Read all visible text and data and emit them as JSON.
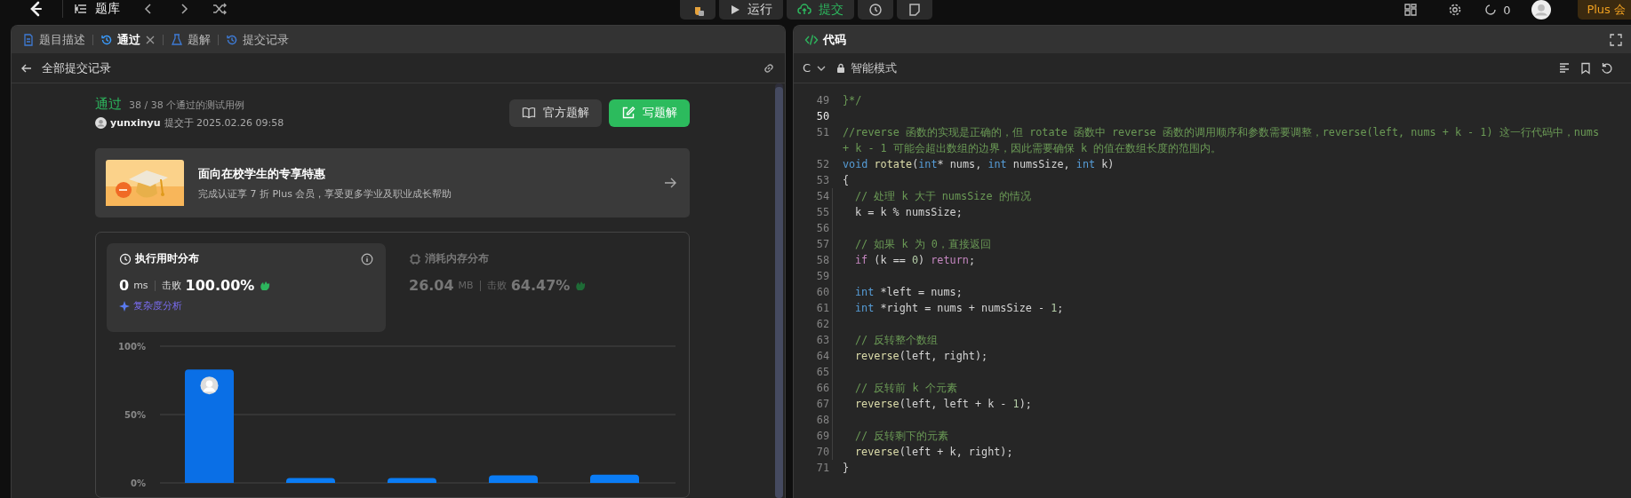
{
  "topbar": {
    "nav_label": "题库",
    "run_button": "运行",
    "submit_button": "提交",
    "streak": "0",
    "plus_label": "Plus 会"
  },
  "left_panel": {
    "tabs": [
      {
        "label": "题目描述",
        "selected": false,
        "closable": false
      },
      {
        "label": "通过",
        "selected": true,
        "closable": true
      },
      {
        "label": "题解",
        "selected": false,
        "closable": false
      },
      {
        "label": "提交记录",
        "selected": false,
        "closable": false
      }
    ],
    "back_label": "全部提交记录",
    "result": {
      "status": "通过",
      "passed": "38 / 38 个通过的测试用例",
      "user": "yunxinyu",
      "submitted": "提交于 2025.02.26 09:58"
    },
    "buttons": [
      {
        "label": "官方题解",
        "kind": "secondary"
      },
      {
        "label": "写题解",
        "kind": "primary"
      }
    ],
    "promo": {
      "title": "面向在校学生的专享特惠",
      "subtitle": "完成认证享 7 折 Plus 会员，享受更多学业及职业成长帮助"
    },
    "stats": [
      {
        "title": "执行用时分布",
        "selected": true,
        "value": "0",
        "unit": "ms",
        "beats_label": "击败",
        "beats": "100.00%",
        "link": "复杂度分析"
      },
      {
        "title": "消耗内存分布",
        "selected": false,
        "value": "26.04",
        "unit": "MB",
        "beats_label": "击败",
        "beats": "64.47%"
      }
    ],
    "chart_data": {
      "type": "bar",
      "values": [
        83,
        3.5,
        3.5,
        5.5,
        6
      ],
      "ylim": [
        0,
        100
      ],
      "yticks": [
        {
          "value": 0,
          "label": "0%"
        },
        {
          "value": 50,
          "label": "50%"
        },
        {
          "value": 100,
          "label": "100%"
        }
      ]
    },
    "chart_user_marker": true
  },
  "right_panel": {
    "title": "代码",
    "language": "C",
    "mode": "智能模式",
    "lines": [
      {
        "no": "49",
        "active": false,
        "indented": false,
        "tokens": [
          {
            "text": "}*/",
            "kind": "comment"
          }
        ]
      },
      {
        "no": "50",
        "active": true,
        "indented": false
      },
      {
        "no": "51",
        "active": false,
        "indented": false,
        "tokens": [
          {
            "text": "//reverse 函数的实现是正确的，但 rotate 函数中 reverse 函数的调用顺序和参数需要调整，reverse(left, nums + k - 1) 这一行代码中，nums + k - 1 可能会超出数组的边界，因此需要确保 k 的值在数组长度的范围内。",
            "kind": "comment"
          }
        ]
      },
      {
        "no": "52",
        "active": false,
        "indented": false,
        "tokens": [
          {
            "text": "void ",
            "kind": "keyword"
          },
          {
            "text": "rotate",
            "kind": "function"
          },
          {
            "text": "(",
            "kind": "plain"
          },
          {
            "text": "int",
            "kind": "keyword"
          },
          {
            "text": "* nums, ",
            "kind": "plain"
          },
          {
            "text": "int",
            "kind": "keyword"
          },
          {
            "text": " numsSize, ",
            "kind": "plain"
          },
          {
            "text": "int",
            "kind": "keyword"
          },
          {
            "text": " k)",
            "kind": "plain"
          }
        ]
      },
      {
        "no": "53",
        "active": false,
        "indented": false,
        "tokens": [
          {
            "text": "{",
            "kind": "plain"
          }
        ]
      },
      {
        "no": "54",
        "active": false,
        "indented": true,
        "tokens": [
          {
            "text": "// 处理 k 大于 numsSize 的情况",
            "kind": "comment"
          }
        ]
      },
      {
        "no": "55",
        "active": false,
        "indented": true,
        "tokens": [
          {
            "text": "k = k % numsSize;",
            "kind": "plain"
          }
        ]
      },
      {
        "no": "56",
        "active": false,
        "indented": true
      },
      {
        "no": "57",
        "active": false,
        "indented": true,
        "tokens": [
          {
            "text": "// 如果 k 为 0，直接返回",
            "kind": "comment"
          }
        ]
      },
      {
        "no": "58",
        "active": false,
        "indented": true,
        "tokens": [
          {
            "text": "if",
            "kind": "control"
          },
          {
            "text": " (k == ",
            "kind": "plain"
          },
          {
            "text": "0",
            "kind": "number"
          },
          {
            "text": ") ",
            "kind": "plain"
          },
          {
            "text": "return",
            "kind": "control"
          },
          {
            "text": ";",
            "kind": "plain"
          }
        ]
      },
      {
        "no": "59",
        "active": false,
        "indented": true
      },
      {
        "no": "60",
        "active": false,
        "indented": true,
        "tokens": [
          {
            "text": "int",
            "kind": "keyword"
          },
          {
            "text": " *left = nums;",
            "kind": "plain"
          }
        ]
      },
      {
        "no": "61",
        "active": false,
        "indented": true,
        "tokens": [
          {
            "text": "int",
            "kind": "keyword"
          },
          {
            "text": " *right = nums + numsSize - ",
            "kind": "plain"
          },
          {
            "text": "1",
            "kind": "number"
          },
          {
            "text": ";",
            "kind": "plain"
          }
        ]
      },
      {
        "no": "62",
        "active": false,
        "indented": true
      },
      {
        "no": "63",
        "active": false,
        "indented": true,
        "tokens": [
          {
            "text": "// 反转整个数组",
            "kind": "comment"
          }
        ]
      },
      {
        "no": "64",
        "active": false,
        "indented": true,
        "tokens": [
          {
            "text": "reverse",
            "kind": "function"
          },
          {
            "text": "(left, right);",
            "kind": "plain"
          }
        ]
      },
      {
        "no": "65",
        "active": false,
        "indented": true
      },
      {
        "no": "66",
        "active": false,
        "indented": true,
        "tokens": [
          {
            "text": "// 反转前 k 个元素",
            "kind": "comment"
          }
        ]
      },
      {
        "no": "67",
        "active": false,
        "indented": true,
        "tokens": [
          {
            "text": "reverse",
            "kind": "function"
          },
          {
            "text": "(left, left + k - ",
            "kind": "plain"
          },
          {
            "text": "1",
            "kind": "number"
          },
          {
            "text": ");",
            "kind": "plain"
          }
        ]
      },
      {
        "no": "68",
        "active": false,
        "indented": true
      },
      {
        "no": "69",
        "active": false,
        "indented": true,
        "tokens": [
          {
            "text": "// 反转剩下的元素",
            "kind": "comment"
          }
        ]
      },
      {
        "no": "70",
        "active": false,
        "indented": true,
        "tokens": [
          {
            "text": "reverse",
            "kind": "function"
          },
          {
            "text": "(left + k, right);",
            "kind": "plain"
          }
        ]
      },
      {
        "no": "71",
        "active": false,
        "indented": false,
        "tokens": [
          {
            "text": "}",
            "kind": "plain"
          }
        ]
      }
    ]
  }
}
